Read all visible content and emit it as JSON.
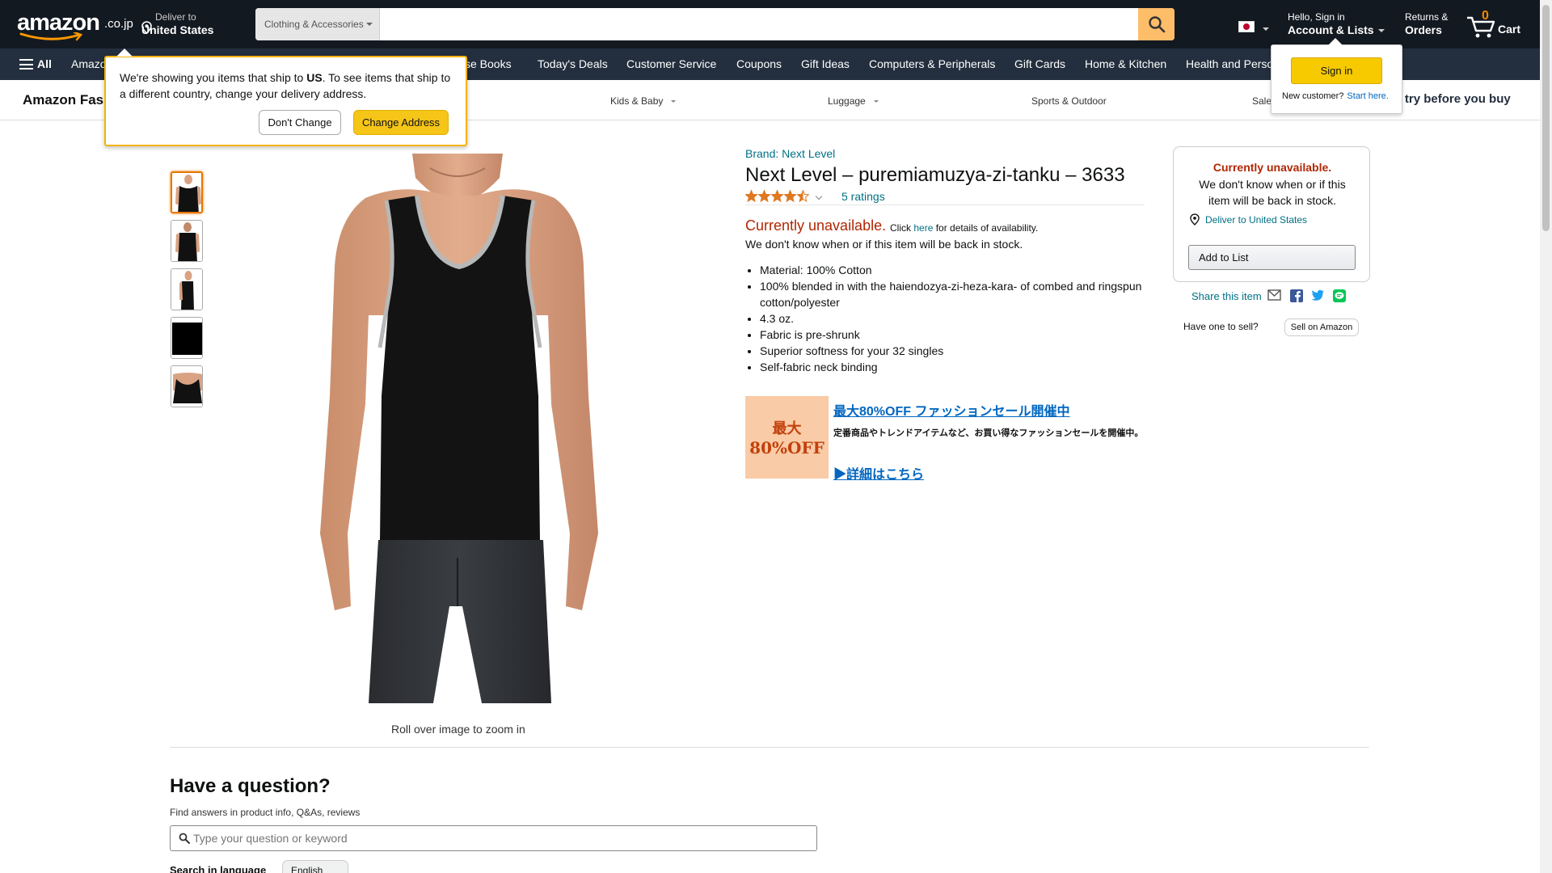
{
  "header": {
    "logo_text": "amazon",
    "logo_tld": ".co.jp",
    "deliver_line1": "Deliver to",
    "deliver_line2": "United States",
    "search_category": "Clothing & Accessories",
    "search_value": "",
    "account_line1": "Hello, Sign in",
    "account_line2": "Account & Lists",
    "returns_line1": "Returns &",
    "returns_line2": "Orders",
    "cart_count": "0",
    "cart_label": "Cart"
  },
  "subnav": {
    "all_label": "All",
    "items": [
      "Amazon",
      "se Books",
      "Today's Deals",
      "Customer Service",
      "Coupons",
      "Gift Ideas",
      "Computers & Peripherals",
      "Gift Cards",
      "Home & Kitchen",
      "Health and Perso"
    ]
  },
  "storebar": {
    "title": "Amazon Fas",
    "categories": [
      "Kids & Baby",
      "Luggage",
      "Sports & Outdoor",
      "Sale"
    ],
    "promo_prefix": "me",
    "promo_text": " try before you buy"
  },
  "popover": {
    "msg_part1": "We're showing you items that ship to ",
    "msg_bold": "US",
    "msg_part2": ". To see items that ship to a different country, change your delivery address.",
    "dont_change": "Don't Change",
    "change_address": "Change Address"
  },
  "signin_flyout": {
    "button": "Sign in",
    "new_customer": "New customer?",
    "start_here": "Start here."
  },
  "gallery": {
    "thumbnail_count": 5,
    "active_index": 0,
    "roll_text": "Roll over image to zoom in"
  },
  "product": {
    "brand": "Brand: Next Level",
    "title": "Next Level – puremiamuzya-zi-tanku – 3633",
    "rating_value": 4.5,
    "ratings_count": "5 ratings",
    "unavailable": "Currently unavailable.",
    "click": "Click",
    "here": "here",
    "details_note": "for details of availability.",
    "unknown_stock": "We don't know when or if this item will be back in stock.",
    "bullets": [
      "Material: 100% Cotton",
      "100% blended in with the haiendozya-zi-heza-kara- of combed and ringspun cotton/polyester",
      "4.3 oz.",
      "Fabric is pre-shrunk",
      "Superior softness for your 32 singles",
      "Self-fabric neck binding"
    ]
  },
  "ad": {
    "img_line1": "最大",
    "img_line2": "80%OFF",
    "headline": "最大80%OFF ファッションセール開催中",
    "desc": "定番商品やトレンドアイテムなど、お買い得なファッションセールを開催中。",
    "more": "▶詳細はこちら"
  },
  "buybox": {
    "unavailable": "Currently unavailable.",
    "note": "We don't know when or if this item will be back in stock.",
    "deliver": "Deliver to United States",
    "add_to_list": "Add to List",
    "share": "Share this item",
    "sell_question": "Have one to sell?",
    "sell_button": "Sell on Amazon"
  },
  "qa": {
    "title": "Have a question?",
    "subtitle": "Find answers in product info, Q&As, reviews",
    "placeholder": "Type your question or keyword",
    "lang_label": "Search in language",
    "lang_value": "English"
  },
  "colors": {
    "nav_dark": "#131921",
    "nav_secondary": "#232f3e",
    "accent_orange": "#febd69",
    "price_red": "#b12704",
    "link_teal": "#007185"
  }
}
